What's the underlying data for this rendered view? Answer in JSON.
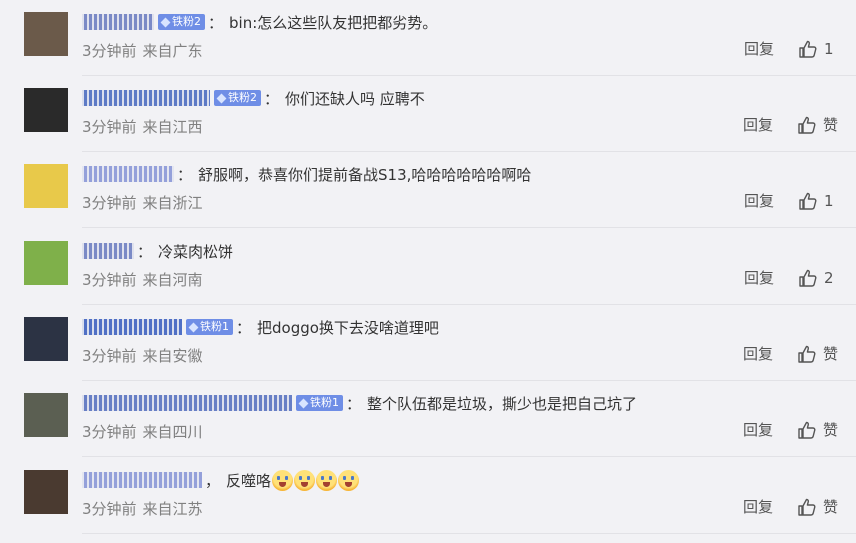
{
  "comments": [
    {
      "username_masked": "░░░░░░░",
      "badge": "铁粉2",
      "text": "bin:怎么这些队友把把都劣势。",
      "time": "3分钟前",
      "location": "来自广东",
      "reply_label": "回复",
      "like_label": "1",
      "avatar_color": "#6b5a4a",
      "name_color": "#6f7fc2"
    },
    {
      "username_masked": "░░░░░░░",
      "badge": "铁粉2",
      "text": "你们还缺人吗 应聘不",
      "time": "3分钟前",
      "location": "来自江西",
      "reply_label": "回复",
      "like_label": "赞",
      "avatar_color": "#2a2a2a",
      "name_color": "#4f6fc2"
    },
    {
      "username_masked": "░░░░░░░",
      "badge": "",
      "text": "舒服啊，恭喜你们提前备战S13,哈哈哈哈哈哈啊哈",
      "time": "3分钟前",
      "location": "来自浙江",
      "reply_label": "回复",
      "like_label": "1",
      "avatar_color": "#e8c94a",
      "name_color": "#8a98d8"
    },
    {
      "username_masked": "░░░░",
      "badge": "",
      "text": "冷菜肉松饼",
      "time": "3分钟前",
      "location": "来自河南",
      "reply_label": "回复",
      "like_label": "2",
      "avatar_color": "#7fb04a",
      "name_color": "#6f7fc2"
    },
    {
      "username_masked": "░░░░░░",
      "badge": "铁粉1",
      "text": "把doggo换下去没啥道理吧",
      "time": "3分钟前",
      "location": "来自安徽",
      "reply_label": "回复",
      "like_label": "赞",
      "avatar_color": "#2c3344",
      "name_color": "#3f63c0"
    },
    {
      "username_masked": "░░░░░░░░░░",
      "badge": "铁粉1",
      "text": "整个队伍都是垃圾，撕少也是把自己坑了",
      "time": "3分钟前",
      "location": "来自四川",
      "reply_label": "回复",
      "like_label": "赞",
      "avatar_color": "#5b5f52",
      "name_color": "#5a73c0"
    },
    {
      "username_masked": "░░░░░░",
      "badge": "",
      "text": "反噬咯",
      "time": "3分钟前",
      "location": "来自江苏",
      "reply_label": "回复",
      "like_label": "赞",
      "avatar_color": "#4a3a30",
      "name_color": "#8a98d8",
      "emojis": [
        "scream-emoji",
        "scream-emoji",
        "scream-emoji",
        "scream-emoji"
      ]
    }
  ],
  "comment_punct": {
    "colon": "：",
    "comma": "，"
  }
}
